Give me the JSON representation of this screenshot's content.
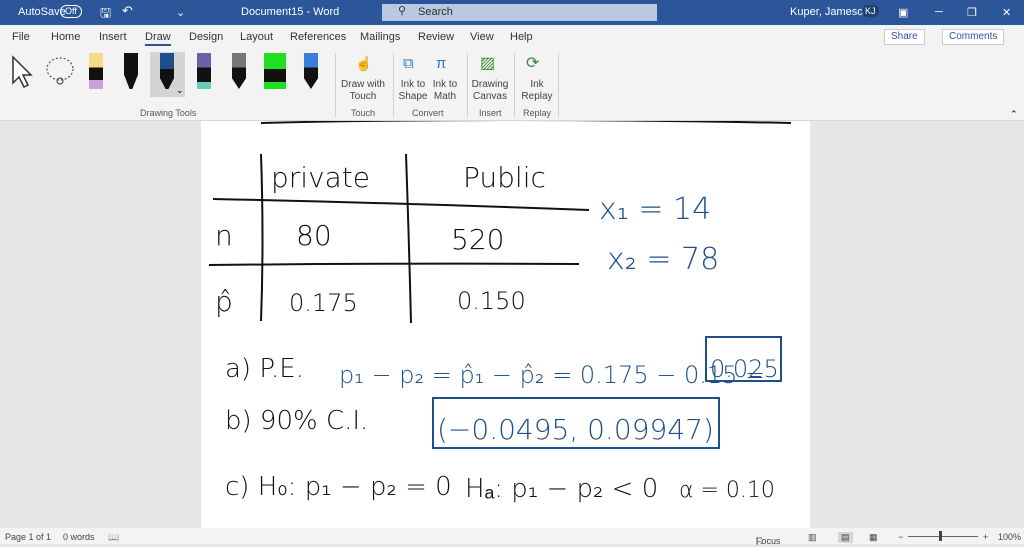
{
  "titlebar": {
    "autosave": "AutoSave",
    "autosave_state": "Off",
    "title": "Document15 - Word",
    "search": "Search",
    "user": "Kuper, Jameson",
    "initials": "KJ"
  },
  "tabs": [
    "File",
    "Home",
    "Insert",
    "Draw",
    "Design",
    "Layout",
    "References",
    "Mailings",
    "Review",
    "View",
    "Help"
  ],
  "active_tab": "Draw",
  "share": "Share",
  "comments": "Comments",
  "ribbon": {
    "drawing_tools": "Drawing Tools",
    "draw_with_touch": "Draw with Touch",
    "touch": "Touch",
    "ink_to_shape": "Ink to Shape",
    "ink_to_math": "Ink to Math",
    "convert": "Convert",
    "drawing_canvas": "Drawing Canvas",
    "insert": "Insert",
    "ink_replay": "Ink Replay",
    "replay": "Replay"
  },
  "ink": {
    "col_private": "private",
    "col_public": "Public",
    "row_n": "n",
    "row_phat": "p̂",
    "n_private": "80",
    "n_public": "520",
    "p_private": "0.175",
    "p_public": "0.150",
    "x1": "x₁ = 14",
    "x2": "x₂ = 78",
    "a_label": "a) P.E.",
    "a_expr": "p₁ − p₂ = p̂₁ − p̂₂ = 0.175 − 0.15 =",
    "a_result": "0.025",
    "b_label": "b) 90% C.I.",
    "b_result": "(−0.0495, 0.09947)",
    "c_h0": "c) H₀: p₁ − p₂ = 0",
    "c_ha": "Hₐ: p₁ − p₂ < 0",
    "c_alpha": "α = 0.10",
    "ink_blue": "#1f4f8a",
    "ink_black": "#111111"
  },
  "status": {
    "page": "Page 1 of 1",
    "words": "0 words",
    "focus": "Focus",
    "zoom": "100%"
  }
}
